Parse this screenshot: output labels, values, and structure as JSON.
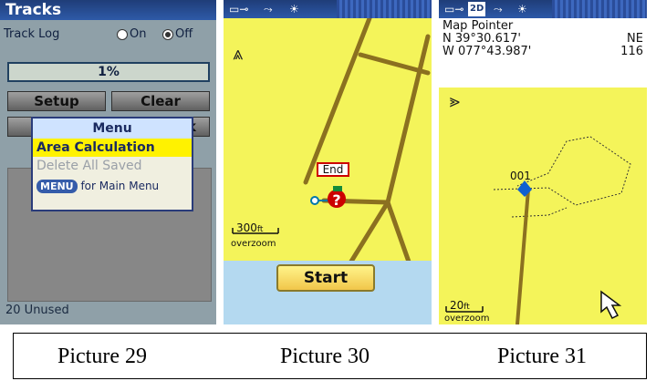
{
  "picture29": {
    "title": "Tracks",
    "track_log_label": "Track Log",
    "on_label": "On",
    "off_label": "Off",
    "selected_mode": "Off",
    "percent_full": "1%",
    "setup_button": "Setup",
    "clear_button": "Clear",
    "partial_button_char": "k",
    "menu": {
      "title": "Menu",
      "items": [
        "Area Calculation",
        "Delete All Saved"
      ],
      "hint_key": "MENU",
      "hint_text": "for Main Menu"
    },
    "footer": "20 Unused"
  },
  "picture30": {
    "north_icon": "north-arrow",
    "end_label": "End",
    "scale_value": "300",
    "scale_unit": "ft",
    "zoom_text": "overzoom",
    "start_button": "Start"
  },
  "picture31": {
    "mode_badge": "2D",
    "pointer_title": "Map Pointer",
    "lat": "N  39°30.617'",
    "lon": "W 077°43.987'",
    "bearing": "NE",
    "distance": "116",
    "waypoint_label": "001",
    "scale_value": "20",
    "scale_unit": "ft",
    "zoom_text": "overzoom"
  },
  "captions": [
    "Picture 29",
    "Picture 30",
    "Picture 31"
  ],
  "colors": {
    "map_yellow": "#f4f45a",
    "road_brown": "#8b7020",
    "title_blue": "#1f3d78",
    "menu_highlight": "#fff200"
  }
}
